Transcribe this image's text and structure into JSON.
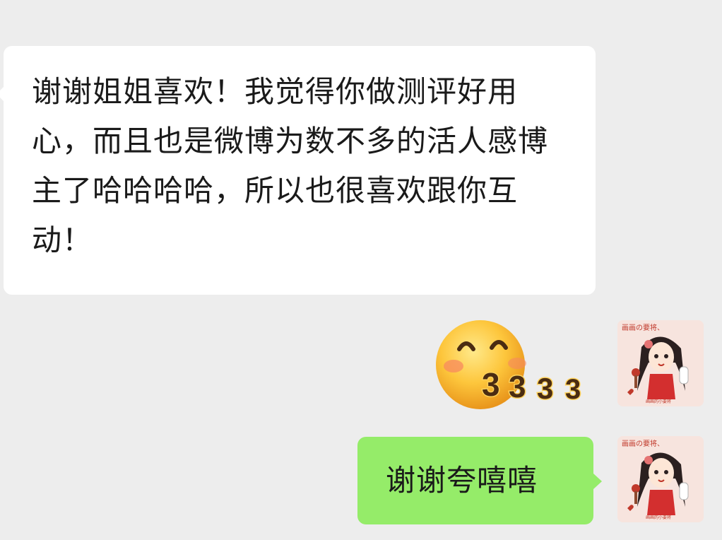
{
  "messages": [
    {
      "direction": "received",
      "text": "谢谢姐姐喜欢！我觉得你做测评好用心，而且也是微博为数不多的活人感博主了哈哈哈哈，所以也很喜欢跟你互动！"
    },
    {
      "direction": "sent",
      "type": "sticker",
      "sticker_name": "smiling-face-333-sticker",
      "sticker_text": "333"
    },
    {
      "direction": "sent",
      "text": "谢谢夸嘻嘻"
    }
  ],
  "avatar": {
    "caption": "画画の要将、",
    "subcaption": "画画的小要将"
  },
  "colors": {
    "background": "#ededed",
    "received_bubble": "#ffffff",
    "sent_bubble": "#95ec69"
  }
}
